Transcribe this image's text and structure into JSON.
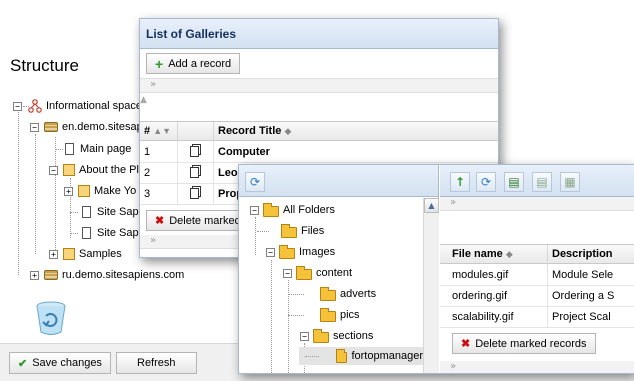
{
  "structure": {
    "title": "Structure",
    "tree": [
      {
        "label": "Informational space"
      },
      {
        "label": "en.demo.sitesapi"
      },
      {
        "label": "Main page"
      },
      {
        "label": "About the Pl"
      },
      {
        "label": "Make Yo"
      },
      {
        "label": "Site Sapi"
      },
      {
        "label": "Site Sapi"
      },
      {
        "label": "Samples"
      },
      {
        "label": "ru.demo.sitesapiens.com"
      }
    ],
    "save_label": "Save changes",
    "refresh_label": "Refresh"
  },
  "galleries": {
    "title": "List of Galleries",
    "add_label": "Add a record",
    "strip_glyph": "»",
    "collapse_glyph": "»",
    "columns": {
      "num": "#",
      "title": "Record Title"
    },
    "rows": [
      {
        "num": "1",
        "title": "Computer"
      },
      {
        "num": "2",
        "title": "Leo"
      },
      {
        "num": "3",
        "title": "Prop"
      }
    ],
    "delete_label": "Delete marked"
  },
  "files": {
    "folders": [
      {
        "label": "All Folders"
      },
      {
        "label": "Files"
      },
      {
        "label": "Images"
      },
      {
        "label": "content"
      },
      {
        "label": "adverts"
      },
      {
        "label": "pics"
      },
      {
        "label": "sections"
      },
      {
        "label": "fortopmanager"
      }
    ],
    "columns": {
      "name": "File name",
      "desc": "Description"
    },
    "rows": [
      {
        "name": "modules.gif",
        "desc": "Module Sele"
      },
      {
        "name": "ordering.gif",
        "desc": "Ordering a S"
      },
      {
        "name": "scalability.gif",
        "desc": "Project Scal"
      }
    ],
    "delete_label": "Delete marked records",
    "colors": {
      "folder": "#f6c23a",
      "accent": "#2f7ac0"
    }
  }
}
